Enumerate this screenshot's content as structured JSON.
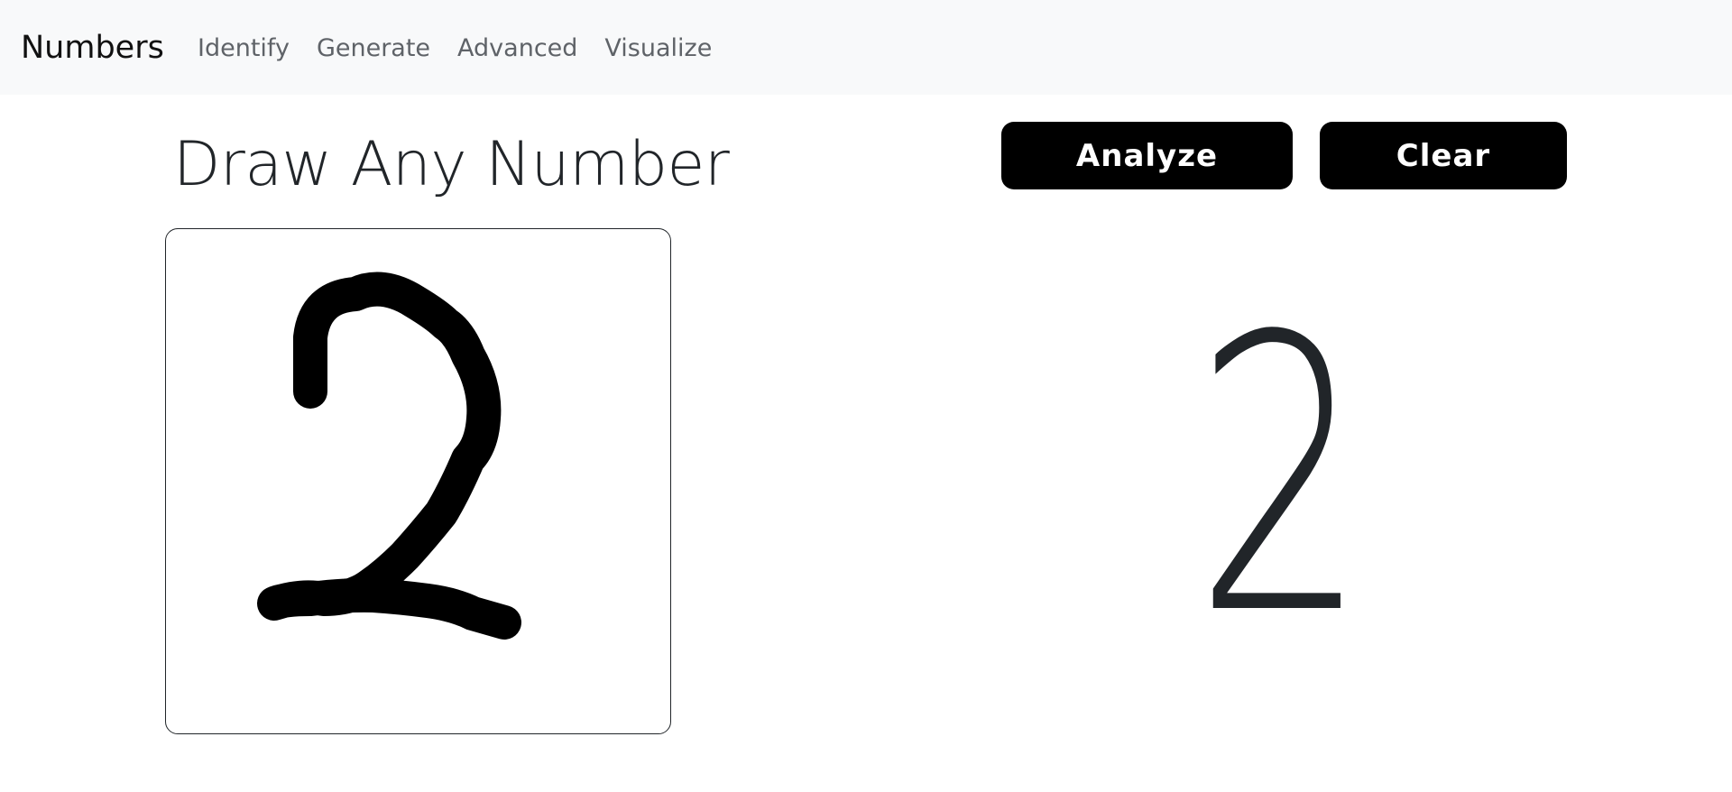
{
  "navbar": {
    "brand": "Numbers",
    "links": [
      {
        "label": "Identify"
      },
      {
        "label": "Generate"
      },
      {
        "label": "Advanced"
      },
      {
        "label": "Visualize"
      }
    ]
  },
  "main": {
    "title": "Draw Any Number",
    "buttons": {
      "analyze_label": "Analyze",
      "clear_label": "Clear"
    },
    "result": {
      "digit": "2"
    }
  },
  "colors": {
    "navbar_bg": "#f8f9fa",
    "button_bg": "#000000",
    "button_text": "#ffffff",
    "stroke": "#000000"
  }
}
